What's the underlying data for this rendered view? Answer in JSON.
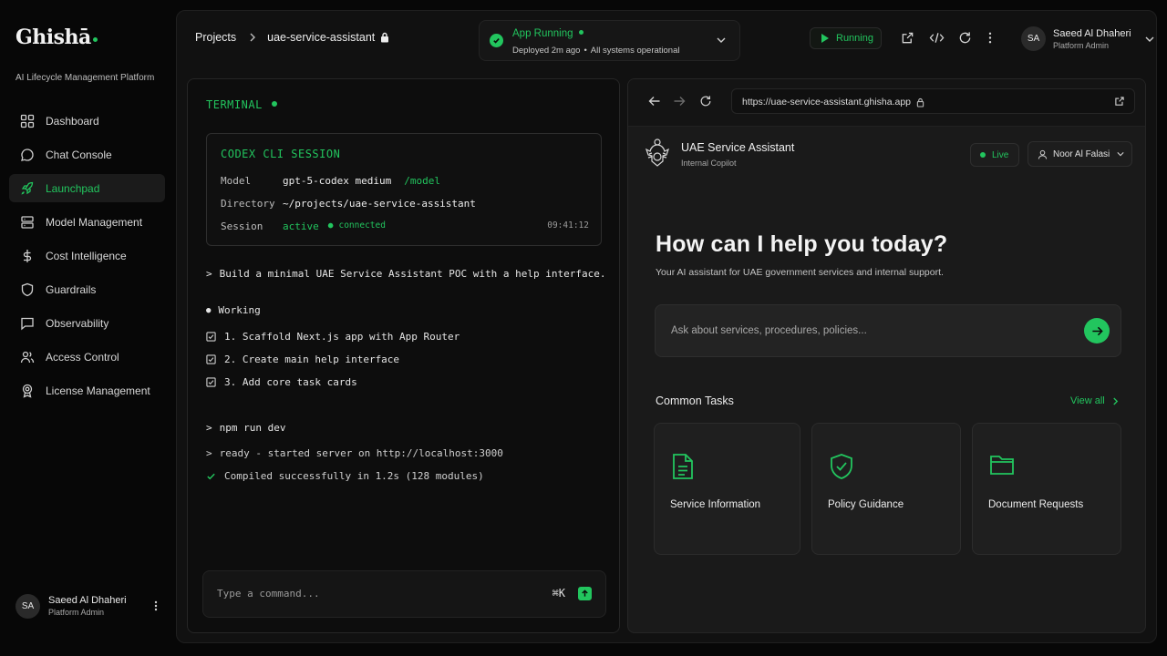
{
  "brand": {
    "name": "Ghishā",
    "tagline": "AI Lifecycle Management Platform"
  },
  "sidebar": {
    "items": [
      {
        "label": "Dashboard",
        "icon": "grid-icon"
      },
      {
        "label": "Chat Console",
        "icon": "chat-bubble-icon"
      },
      {
        "label": "Launchpad",
        "icon": "rocket-icon",
        "active": true
      },
      {
        "label": "Model Management",
        "icon": "database-icon"
      },
      {
        "label": "Cost Intelligence",
        "icon": "dollar-icon"
      },
      {
        "label": "Guardrails",
        "icon": "shield-icon"
      },
      {
        "label": "Observability",
        "icon": "message-square-icon"
      },
      {
        "label": "Access Control",
        "icon": "users-icon"
      },
      {
        "label": "License Management",
        "icon": "award-icon"
      }
    ],
    "user": {
      "initials": "SA",
      "name": "Saeed Al Dhaheri",
      "role": "Platform Admin"
    }
  },
  "topbar": {
    "breadcrumb": {
      "root": "Projects",
      "project": "uae-service-assistant"
    },
    "status": {
      "title": "App Running",
      "deployed": "Deployed 2m ago",
      "systems": "All systems operational"
    },
    "run_label": "Running",
    "user": {
      "initials": "SA",
      "name": "Saeed Al Dhaheri",
      "role": "Platform Admin"
    }
  },
  "terminal": {
    "title": "TERMINAL",
    "session": {
      "title": "CODEX CLI SESSION",
      "model_label": "Model",
      "model_value": "gpt-5-codex medium",
      "model_cmd": "/model",
      "dir_label": "Directory",
      "dir_value": "~/projects/uae-service-assistant",
      "session_label": "Session",
      "session_value": "active",
      "session_state": "connected",
      "time": "09:41:12"
    },
    "prompt": "Build a minimal UAE Service Assistant POC with a help interface.",
    "working": "Working",
    "tasks": [
      "1. Scaffold Next.js app with App Router",
      "2. Create main help interface",
      "3. Add core task cards"
    ],
    "command": "npm run dev",
    "output_ready": "ready - started server on http://localhost:3000",
    "output_compiled": "Compiled successfully in 1.2s (128 modules)",
    "input_placeholder": "Type a command...",
    "shortcut": "⌘K"
  },
  "preview": {
    "url": "https://uae-service-assistant.ghisha.app",
    "app": {
      "title": "UAE Service Assistant",
      "subtitle": "Internal Copilot",
      "live": "Live",
      "user": "Noor Al Falasi"
    },
    "hero": {
      "title": "How can I help you today?",
      "subtitle": "Your AI assistant for UAE government services and internal support."
    },
    "ask_placeholder": "Ask about services, procedures, policies...",
    "common_tasks": {
      "title": "Common Tasks",
      "view_all": "View all",
      "cards": [
        {
          "label": "Service Information",
          "icon": "document-icon"
        },
        {
          "label": "Policy Guidance",
          "icon": "shield-check-icon"
        },
        {
          "label": "Document Requests",
          "icon": "folder-icon"
        }
      ]
    }
  },
  "colors": {
    "accent": "#22c55e",
    "background": "#070707",
    "panel": "#111111"
  }
}
